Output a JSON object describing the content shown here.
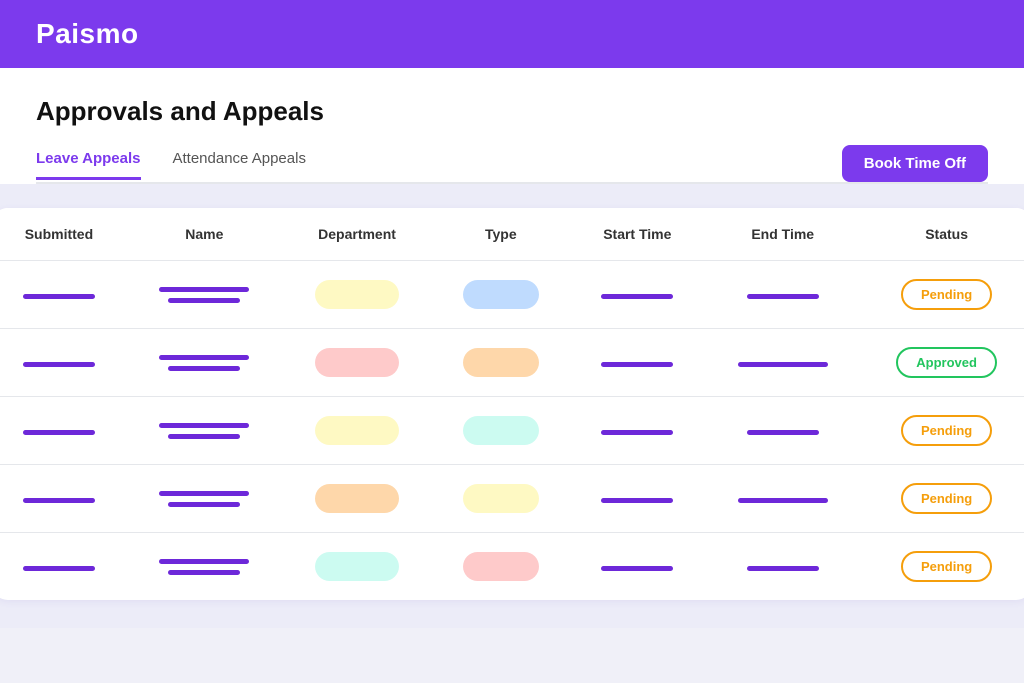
{
  "header": {
    "logo": "Paismo"
  },
  "page": {
    "title": "Approvals and Appeals"
  },
  "tabs": [
    {
      "id": "leave",
      "label": "Leave Appeals",
      "active": true
    },
    {
      "id": "attendance",
      "label": "Attendance Appeals",
      "active": false
    }
  ],
  "book_button": "Book Time Off",
  "table": {
    "columns": [
      "Submitted",
      "Name",
      "Department",
      "Type",
      "Start Time",
      "End Time",
      "Status"
    ],
    "rows": [
      {
        "submitted_lines": [
          "medium"
        ],
        "name_lines": [
          "long",
          "long"
        ],
        "dept_color": "yellow",
        "type_color": "blue",
        "start_lines": [
          "medium"
        ],
        "end_lines": [
          "medium"
        ],
        "status": "Pending",
        "status_type": "pending"
      },
      {
        "submitted_lines": [
          "short"
        ],
        "name_lines": [
          "long",
          "medium"
        ],
        "dept_color": "red",
        "type_color": "orange",
        "start_lines": [
          "medium"
        ],
        "end_lines": [
          "long"
        ],
        "status": "Approved",
        "status_type": "approved"
      },
      {
        "submitted_lines": [
          "short"
        ],
        "name_lines": [
          "long",
          "medium"
        ],
        "dept_color": "yellow",
        "type_color": "teal",
        "start_lines": [
          "medium"
        ],
        "end_lines": [
          "medium"
        ],
        "status": "Pending",
        "status_type": "pending"
      },
      {
        "submitted_lines": [
          "short"
        ],
        "name_lines": [
          "long",
          "long"
        ],
        "dept_color": "orange",
        "type_color": "yellow",
        "start_lines": [
          "medium"
        ],
        "end_lines": [
          "long"
        ],
        "status": "Pending",
        "status_type": "pending"
      },
      {
        "submitted_lines": [
          "short"
        ],
        "name_lines": [
          "long",
          "long"
        ],
        "dept_color": "teal",
        "type_color": "red",
        "start_lines": [
          "medium"
        ],
        "end_lines": [
          "medium"
        ],
        "status": "Pending",
        "status_type": "pending"
      }
    ]
  }
}
